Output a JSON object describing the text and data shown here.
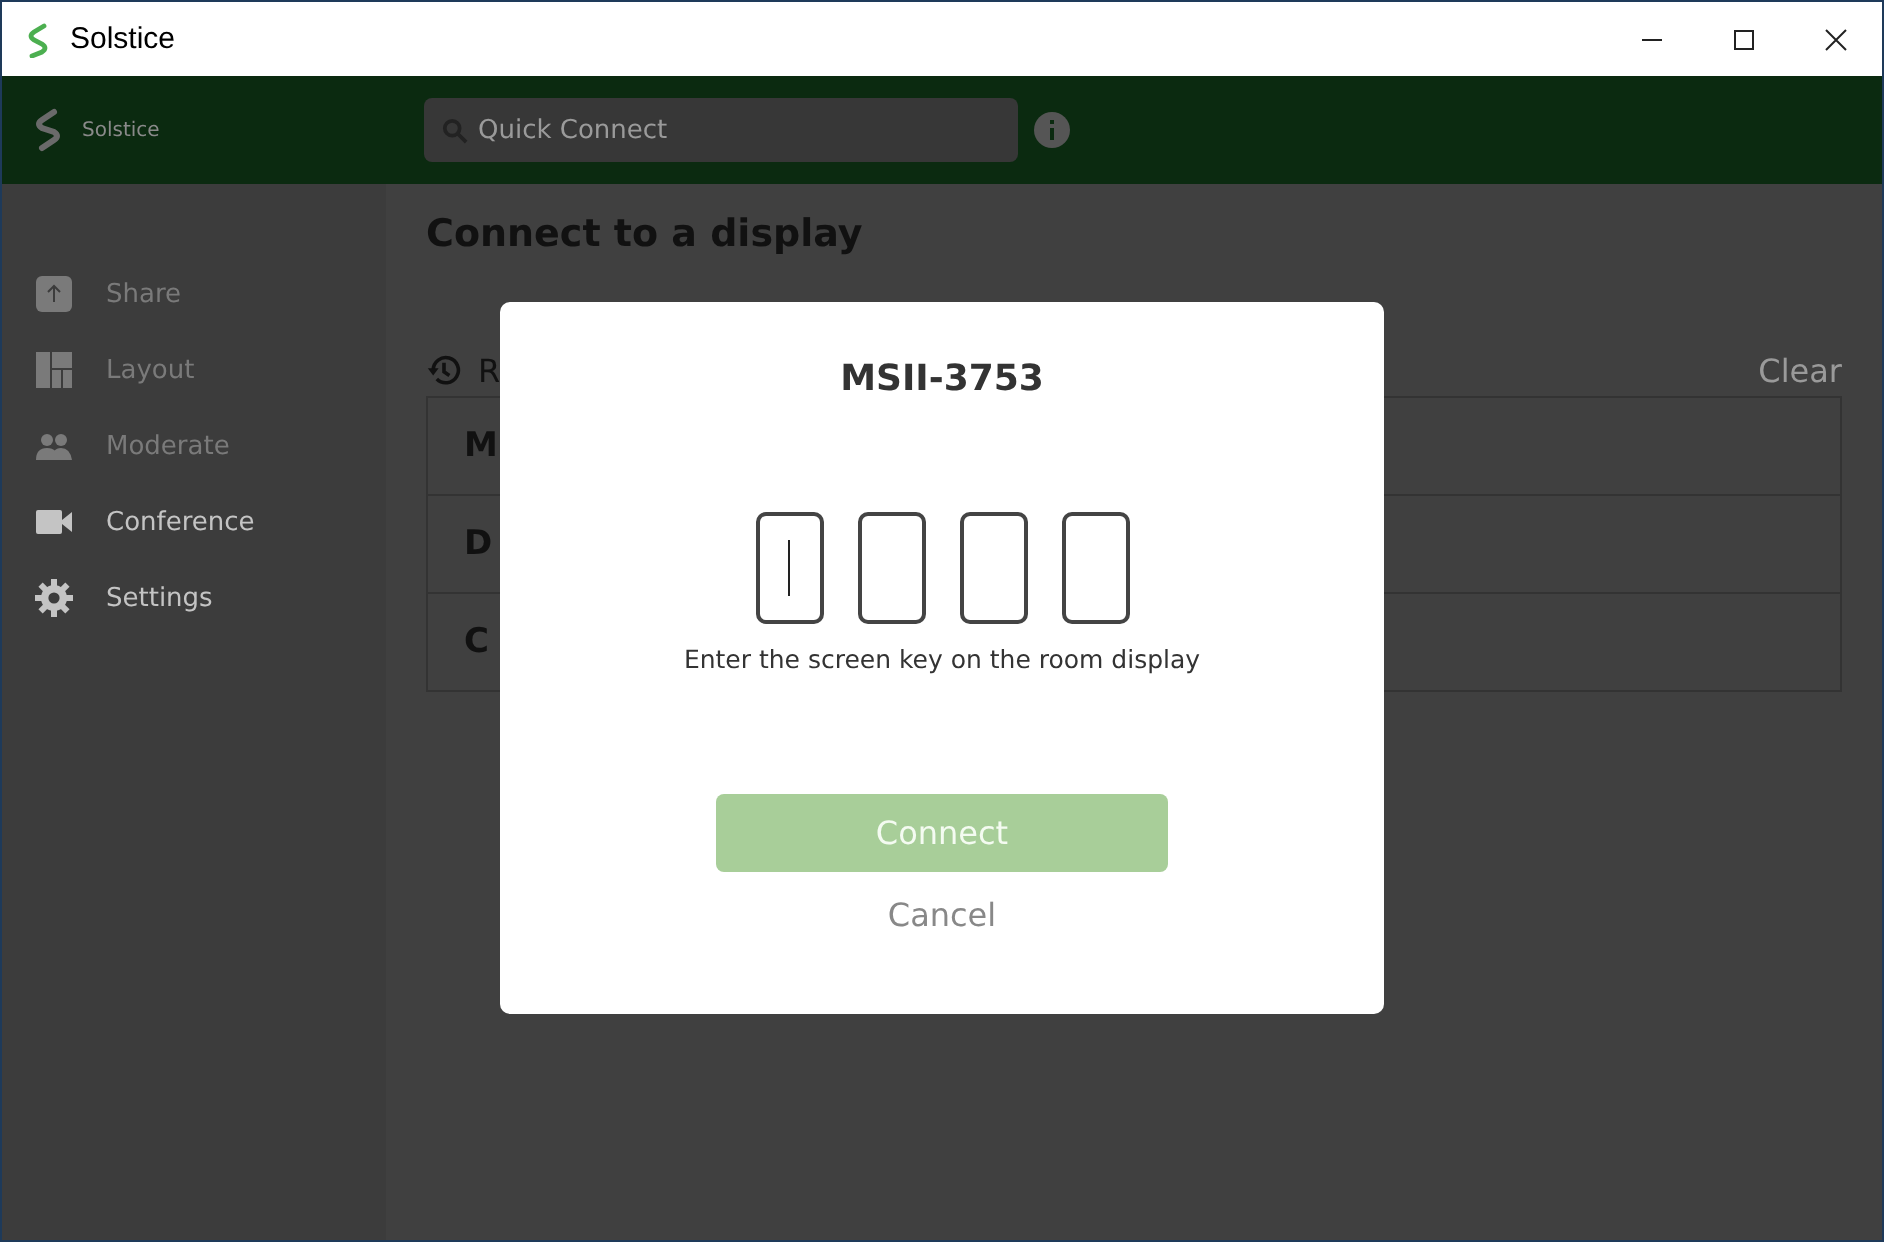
{
  "window": {
    "title": "Solstice"
  },
  "header": {
    "brand": "Solstice",
    "search": {
      "placeholder": "Quick Connect"
    }
  },
  "sidebar": {
    "items": [
      {
        "label": "Share",
        "disabled": true
      },
      {
        "label": "Layout",
        "disabled": true
      },
      {
        "label": "Moderate",
        "disabled": true
      },
      {
        "label": "Conference",
        "disabled": false
      },
      {
        "label": "Settings",
        "disabled": false
      }
    ]
  },
  "main": {
    "title": "Connect to a display",
    "recent_label": "R",
    "clear": "Clear",
    "rows": [
      "M",
      "D",
      "C"
    ]
  },
  "dialog": {
    "title": "MSII-3753",
    "key_boxes": [
      {
        "focused": true
      },
      {
        "focused": false
      },
      {
        "focused": false
      },
      {
        "focused": false
      }
    ],
    "hint": "Enter the screen key on the room display",
    "connect": {
      "label": "Connect",
      "disabled": true
    },
    "cancel": "Cancel"
  }
}
